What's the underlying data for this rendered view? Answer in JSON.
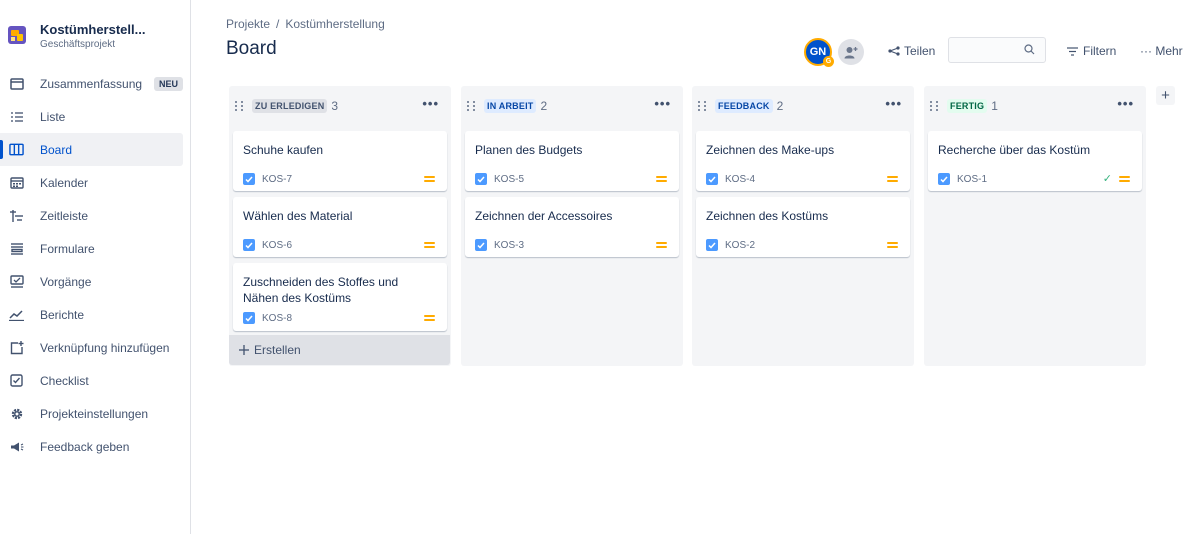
{
  "project": {
    "name": "Kostümherstell...",
    "type": "Geschäftsprojekt"
  },
  "sidebar": {
    "items": [
      {
        "label": "Zusammenfassung",
        "icon": "summary-icon",
        "badge": "NEU"
      },
      {
        "label": "Liste",
        "icon": "list-icon"
      },
      {
        "label": "Board",
        "icon": "board-icon",
        "active": true
      },
      {
        "label": "Kalender",
        "icon": "calendar-icon"
      },
      {
        "label": "Zeitleiste",
        "icon": "timeline-icon"
      },
      {
        "label": "Formulare",
        "icon": "forms-icon"
      },
      {
        "label": "Vorgänge",
        "icon": "issues-icon"
      },
      {
        "label": "Berichte",
        "icon": "reports-icon"
      },
      {
        "label": "Verknüpfung hinzufügen",
        "icon": "add-shortcut-icon"
      },
      {
        "label": "Checklist",
        "icon": "checklist-icon"
      },
      {
        "label": "Projekteinstellungen",
        "icon": "gear-icon"
      },
      {
        "label": "Feedback geben",
        "icon": "megaphone-icon"
      }
    ]
  },
  "header": {
    "breadcrumb": [
      "Projekte",
      "Kostümherstellung"
    ],
    "title": "Board",
    "avatar_initials": "GN",
    "avatar_mini": "G",
    "share_label": "Teilen",
    "search_value": "",
    "filter_label": "Filtern",
    "more_label": "··· Mehr"
  },
  "colors": {
    "accent": "#0052cc",
    "todo_bg": "#dfe1e6",
    "todo_fg": "#42526e",
    "inprogress_bg": "#deebff",
    "inprogress_fg": "#0747a6",
    "done_bg": "#e3fcef",
    "done_fg": "#006644",
    "priority_medium": "#ffab00"
  },
  "columns": [
    {
      "label": "ZU ERLEDIGEN",
      "count": "3",
      "menu": "•••",
      "cards": [
        {
          "title": "Schuhe kaufen",
          "key": "KOS-7"
        },
        {
          "title": "Wählen des Material",
          "key": "KOS-6"
        },
        {
          "title": "Zuschneiden des Stoffes und Nähen des Kostüms",
          "key": "KOS-8"
        }
      ]
    },
    {
      "label": "IN ARBEIT",
      "count": "2",
      "menu": "•••",
      "cards": [
        {
          "title": "Planen des Budgets",
          "key": "KOS-5"
        },
        {
          "title": "Zeichnen der Accessoires",
          "key": "KOS-3"
        }
      ]
    },
    {
      "label": "FEEDBACK",
      "count": "2",
      "menu": "•••",
      "cards": [
        {
          "title": "Zeichnen des Make-ups",
          "key": "KOS-4"
        },
        {
          "title": "Zeichnen des Kostüms",
          "key": "KOS-2"
        }
      ]
    },
    {
      "label": "FERTIG",
      "count": "1",
      "menu": "•••",
      "cards": [
        {
          "title": "Recherche über das Kostüm",
          "key": "KOS-1",
          "done": "✓"
        }
      ]
    }
  ],
  "create_label": "Erstellen",
  "add_column_label": "+"
}
